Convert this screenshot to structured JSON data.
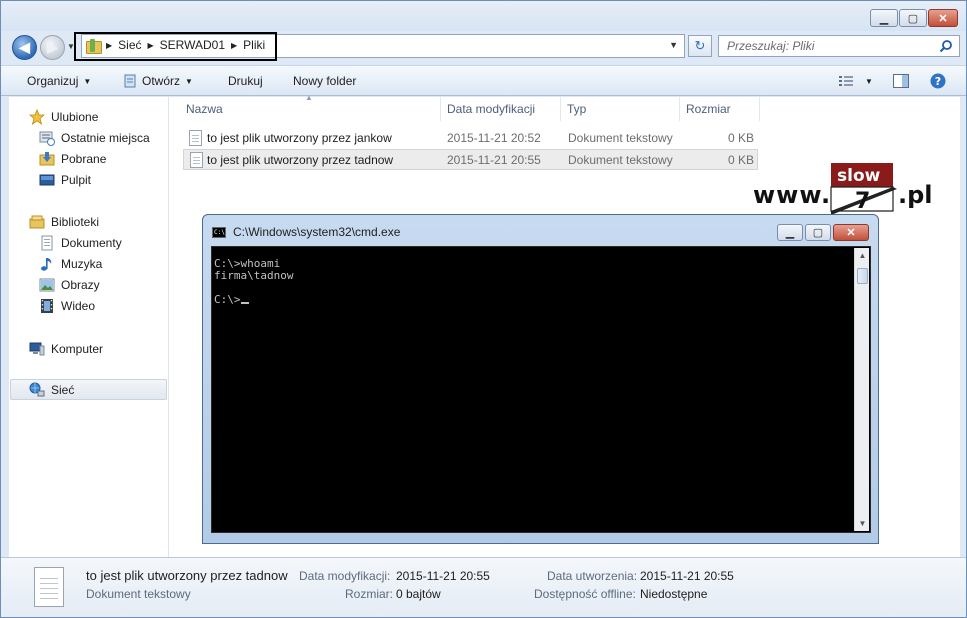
{
  "window": {
    "caption_buttons": {
      "minimize": "▁",
      "maximize": "▢",
      "close": "✕"
    }
  },
  "nav": {
    "back_glyph": "◀",
    "forward_glyph": "▶",
    "breadcrumb": [
      "Sieć",
      "SERWAD01",
      "Pliki"
    ],
    "search_placeholder": "Przeszukaj: Pliki"
  },
  "toolbar": {
    "organize": "Organizuj",
    "open": "Otwórz",
    "print": "Drukuj",
    "new_folder": "Nowy folder"
  },
  "sidebar": {
    "favorites": "Ulubione",
    "recent": "Ostatnie miejsca",
    "downloads": "Pobrane",
    "desktop": "Pulpit",
    "libraries": "Biblioteki",
    "documents": "Dokumenty",
    "music": "Muzyka",
    "pictures": "Obrazy",
    "video": "Wideo",
    "computer": "Komputer",
    "network": "Sieć"
  },
  "columns": {
    "name": "Nazwa",
    "modified": "Data modyfikacji",
    "type": "Typ",
    "size": "Rozmiar"
  },
  "files": [
    {
      "name": "to jest plik utworzony przez jankow",
      "modified": "2015-11-21 20:52",
      "type": "Dokument tekstowy",
      "size": "0 KB"
    },
    {
      "name": "to jest plik utworzony przez tadnow",
      "modified": "2015-11-21 20:55",
      "type": "Dokument tekstowy",
      "size": "0 KB"
    }
  ],
  "watermark": {
    "www": "www.",
    "slow": "slow",
    "seven": "7",
    "pl": ".pl",
    "accent_color": "#8b1a1a"
  },
  "cmd": {
    "title": "C:\\Windows\\system32\\cmd.exe",
    "icon_text": "C:\\",
    "console_text": "C:\\>whoami\nfirma\\tadnow\n\nC:\\>",
    "scroll_up": "▲",
    "scroll_down": "▼"
  },
  "details": {
    "file_name": "to jest plik utworzony przez tadnow",
    "file_type": "Dokument tekstowy",
    "modified_label": "Data modyfikacji:",
    "modified_value": "2015-11-21 20:55",
    "created_label": "Data utworzenia:",
    "created_value": "2015-11-21 20:55",
    "size_label": "Rozmiar:",
    "size_value": "0 bajtów",
    "offline_label": "Dostępność offline:",
    "offline_value": "Niedostępne"
  }
}
